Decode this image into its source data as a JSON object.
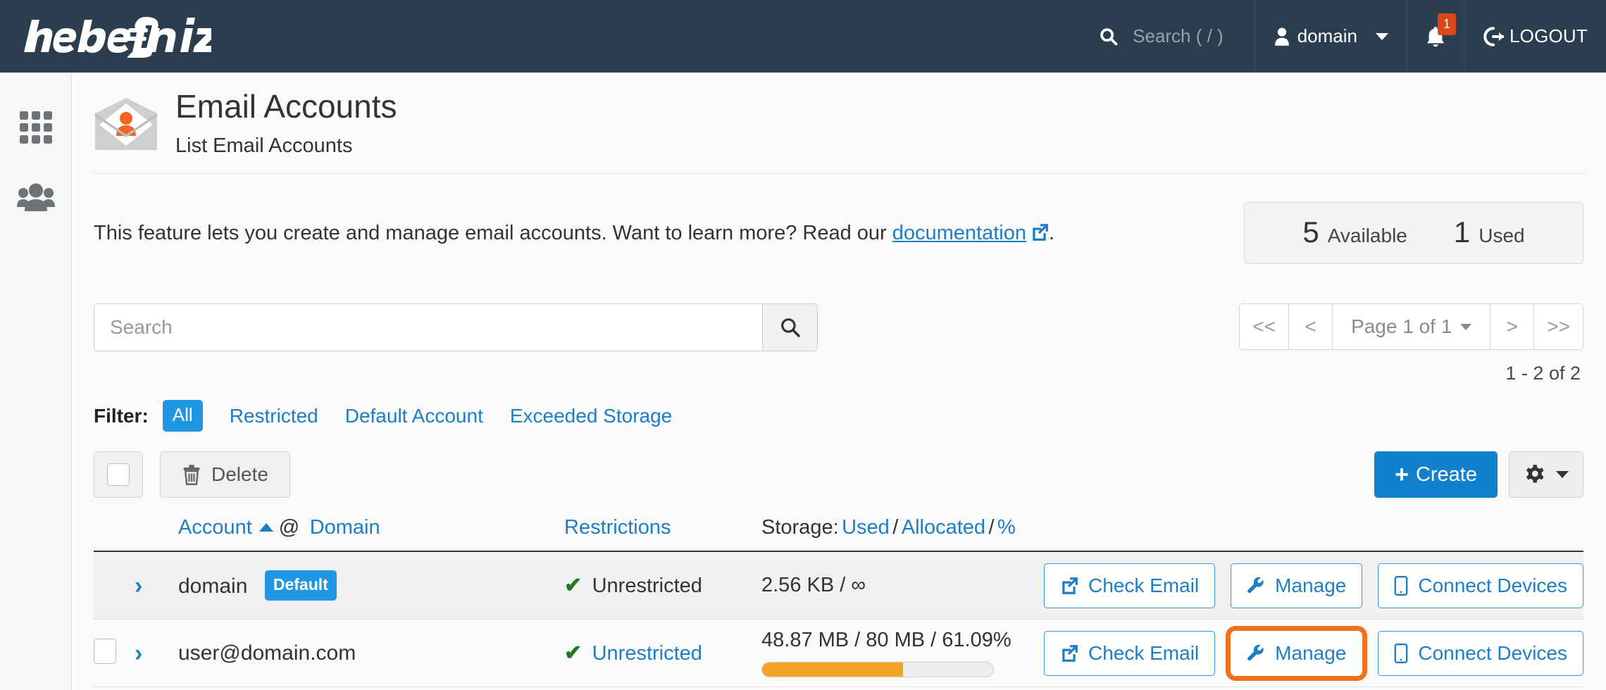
{
  "topnav": {
    "logo_text": "hebelJahiz",
    "search_placeholder": "Search ( / )",
    "search_icon": "search-icon",
    "user_name": "domain",
    "user_icon": "user-icon",
    "notifications_icon": "bell-icon",
    "notifications_count": "1",
    "logout_label": "LOGOUT",
    "logout_icon": "logout-icon",
    "background_color": "#2b3e50"
  },
  "sidebar": {
    "items": [
      {
        "name": "apps-grid-icon",
        "label": "Apps"
      },
      {
        "name": "users-group-icon",
        "label": "Users"
      }
    ]
  },
  "header": {
    "icon": "email-account-icon",
    "title": "Email Accounts",
    "subtitle": "List Email Accounts"
  },
  "intro": {
    "text_before": "This feature lets you create and manage email accounts. Want to learn more? Read our ",
    "link_label": "documentation",
    "link_icon": "external-link-icon",
    "text_after": "."
  },
  "stats": {
    "available_value": "5",
    "available_label": "Available",
    "used_value": "1",
    "used_label": "Used"
  },
  "search": {
    "value": "",
    "placeholder": "Search",
    "button_icon": "search-icon"
  },
  "pagination": {
    "first_label": "<<",
    "prev_label": "<",
    "page_label": "Page 1 of 1",
    "next_label": ">",
    "last_label": ">>",
    "range_label": "1 - 2 of 2"
  },
  "filter": {
    "label": "Filter:",
    "options": [
      {
        "label": "All",
        "active": true
      },
      {
        "label": "Restricted",
        "active": false
      },
      {
        "label": "Default Account",
        "active": false
      },
      {
        "label": "Exceeded Storage",
        "active": false
      }
    ]
  },
  "actions": {
    "select_all_checkbox": "",
    "delete_label": "Delete",
    "delete_icon": "trash-icon",
    "create_label": "Create",
    "create_icon": "plus-icon",
    "settings_icon": "gear-icon"
  },
  "table": {
    "headers": {
      "account": "Account",
      "sort_icon": "sort-asc-caret",
      "at": "@",
      "domain": "Domain",
      "restrictions": "Restrictions",
      "storage_prefix": "Storage:",
      "storage_used": "Used",
      "storage_sep1": "/",
      "storage_allocated": "Allocated",
      "storage_sep2": "/",
      "storage_percent": "%"
    },
    "rows": [
      {
        "has_checkbox": false,
        "expand_icon": "chevron-right-icon",
        "account": "domain",
        "badge": "Default",
        "restriction_icon": "check-icon",
        "restriction": "Unrestricted",
        "restriction_is_link": false,
        "storage": "2.56 KB / ∞",
        "has_progress": false,
        "progress_percent": 0,
        "buttons": [
          {
            "label": "Check Email",
            "icon": "external-link-icon",
            "highlighted": false
          },
          {
            "label": "Manage",
            "icon": "wrench-icon",
            "highlighted": false
          },
          {
            "label": "Connect Devices",
            "icon": "mobile-icon",
            "highlighted": false
          }
        ]
      },
      {
        "has_checkbox": true,
        "expand_icon": "chevron-right-icon",
        "account": "user@domain.com",
        "badge": "",
        "restriction_icon": "check-icon",
        "restriction": "Unrestricted",
        "restriction_is_link": true,
        "storage": "48.87 MB / 80 MB / 61.09%",
        "has_progress": true,
        "progress_percent": 61.09,
        "buttons": [
          {
            "label": "Check Email",
            "icon": "external-link-icon",
            "highlighted": false
          },
          {
            "label": "Manage",
            "icon": "wrench-icon",
            "highlighted": true
          },
          {
            "label": "Connect Devices",
            "icon": "mobile-icon",
            "highlighted": false
          }
        ]
      }
    ]
  },
  "colors": {
    "nav_background": "#2b3e50",
    "link_blue": "#1c7fc6",
    "primary_blue": "#1281cd",
    "badge_blue": "#2196e3",
    "success_green": "#1f7a1f",
    "progress_orange": "#f5a228",
    "highlight_orange": "#f4701b",
    "notification_red": "#d9481b"
  }
}
